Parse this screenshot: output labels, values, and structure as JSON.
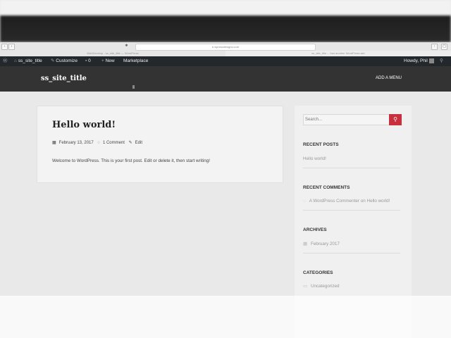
{
  "browser": {
    "url": "b.wpnewdesigns.com",
    "tabs": [
      "WebDevelop - ss_site_title — WordPress",
      "ss_site_title – Just another WordPress site"
    ]
  },
  "admin_bar": {
    "site_name": "ss_site_title",
    "customize": "Customize",
    "comments_count": "0",
    "new": "New",
    "marketplace": "Marketplace",
    "howdy": "Howdy, Phil"
  },
  "site": {
    "title": "ss_site_title",
    "menu": "ADD A MENU"
  },
  "post": {
    "title": "Hello world!",
    "date": "February 13, 2017",
    "comments": "1 Comment",
    "edit": "Edit",
    "body": "Welcome to WordPress. This is your first post. Edit or delete it, then start writing!"
  },
  "sidebar": {
    "search_placeholder": "Search...",
    "recent_posts_title": "RECENT POSTS",
    "recent_post": "Hello world!",
    "recent_comments_title": "RECENT COMMENTS",
    "recent_comment": "A WordPress Commenter on Hello world!",
    "archives_title": "ARCHIVES",
    "archive": "February 2017",
    "categories_title": "CATEGORIES",
    "category": "Uncategorized"
  },
  "icons": {
    "wp": "wordpress-logo-icon",
    "search": "search-icon",
    "calendar": "calendar-icon",
    "comment": "comment-icon",
    "edit": "pencil-icon",
    "folder": "folder-icon"
  },
  "colors": {
    "admin_bar": "#23282d",
    "header": "#333333",
    "accent": "#c9303e",
    "page_bg": "#e9e9e9"
  }
}
